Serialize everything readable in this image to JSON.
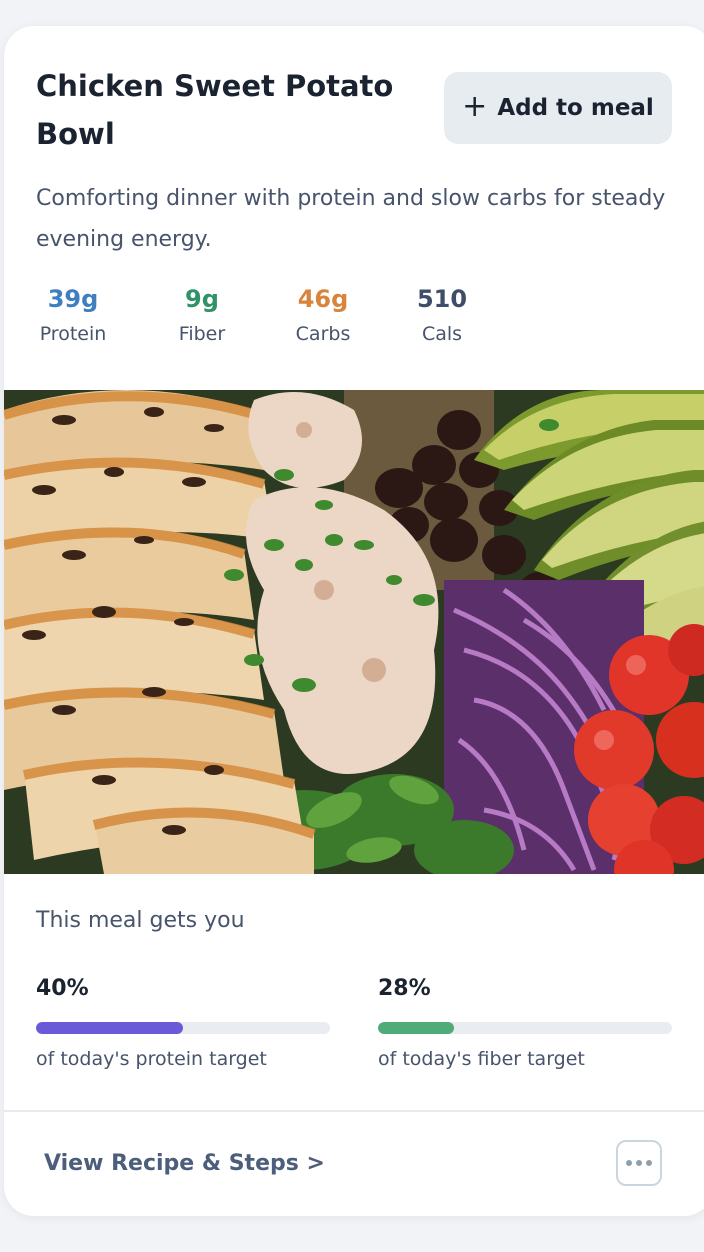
{
  "meal": {
    "title": "Chicken Sweet Potato Bowl",
    "add_button_label": "Add to meal",
    "add_icon": "plus-icon",
    "description": "Comforting dinner with protein and slow carbs for steady evening energy."
  },
  "nutrition": [
    {
      "value": "39g",
      "label": "Protein",
      "color": "#3f7fc0"
    },
    {
      "value": "9g",
      "label": "Fiber",
      "color": "#2f9368"
    },
    {
      "value": "46g",
      "label": "Carbs",
      "color": "#d8843a"
    },
    {
      "value": "510",
      "label": "Cals",
      "color": "#3f4e68"
    }
  ],
  "image": {
    "subject": "meal-photo"
  },
  "progress": {
    "intro": "This meal gets you",
    "protein": {
      "percent_label": "40%",
      "fraction": 0.5,
      "caption": "of today's protein target",
      "color": "#6a5ad8"
    },
    "fiber": {
      "percent_label": "28%",
      "fraction": 0.26,
      "caption": "of today's fiber target",
      "color": "#4fab78"
    }
  },
  "footer": {
    "recipe_link": "View Recipe & Steps >",
    "more_icon": "more-options-icon"
  }
}
